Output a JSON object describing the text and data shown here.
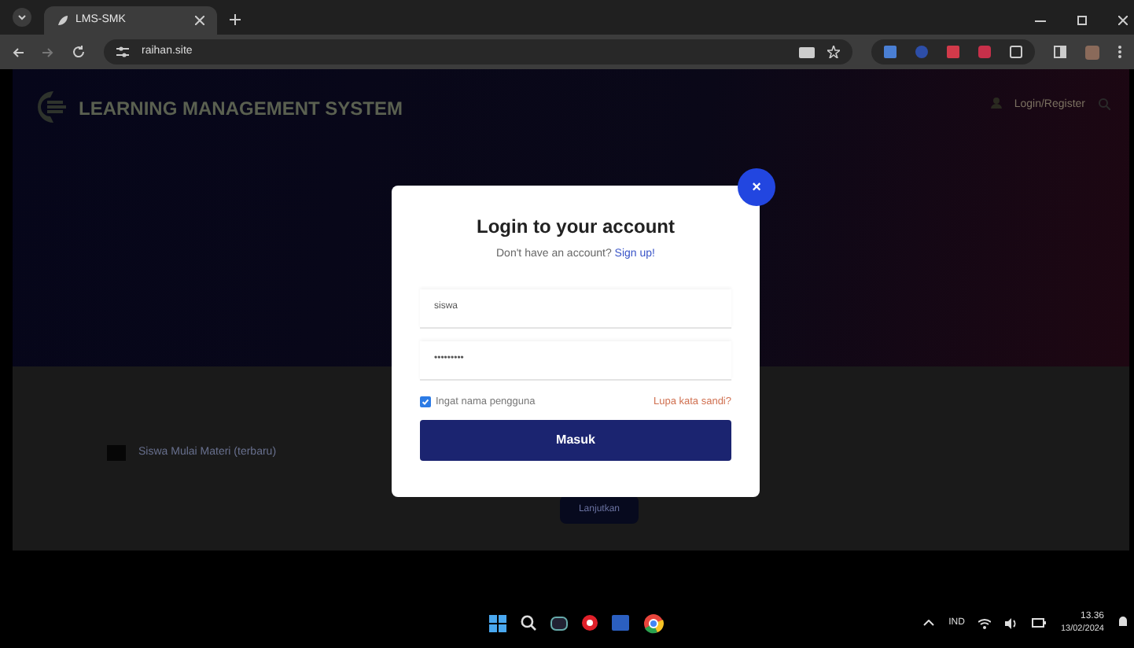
{
  "browser": {
    "tab": {
      "title": "LMS-SMK",
      "selected": true
    },
    "url": "raihan.site"
  },
  "site": {
    "brand": "LEARNING MANAGEMENT SYSTEM",
    "nav_link": "Login/Register",
    "course_item": "Siswa Mulai Materi (terbaru)",
    "continue_button": "Lanjutkan"
  },
  "modal": {
    "close": "×",
    "title": "Login to your account",
    "prompt": "Don't have an account?",
    "signup_link": "Sign up!",
    "username": "siswa",
    "password": "•••••••••",
    "remember": {
      "label": "Ingat nama pengguna",
      "checked": true
    },
    "forgot_link": "Lupa kata sandi?",
    "submit": "Masuk"
  },
  "taskbar": {
    "language": "IND",
    "time": "13.36",
    "date": "13/02/2024"
  }
}
